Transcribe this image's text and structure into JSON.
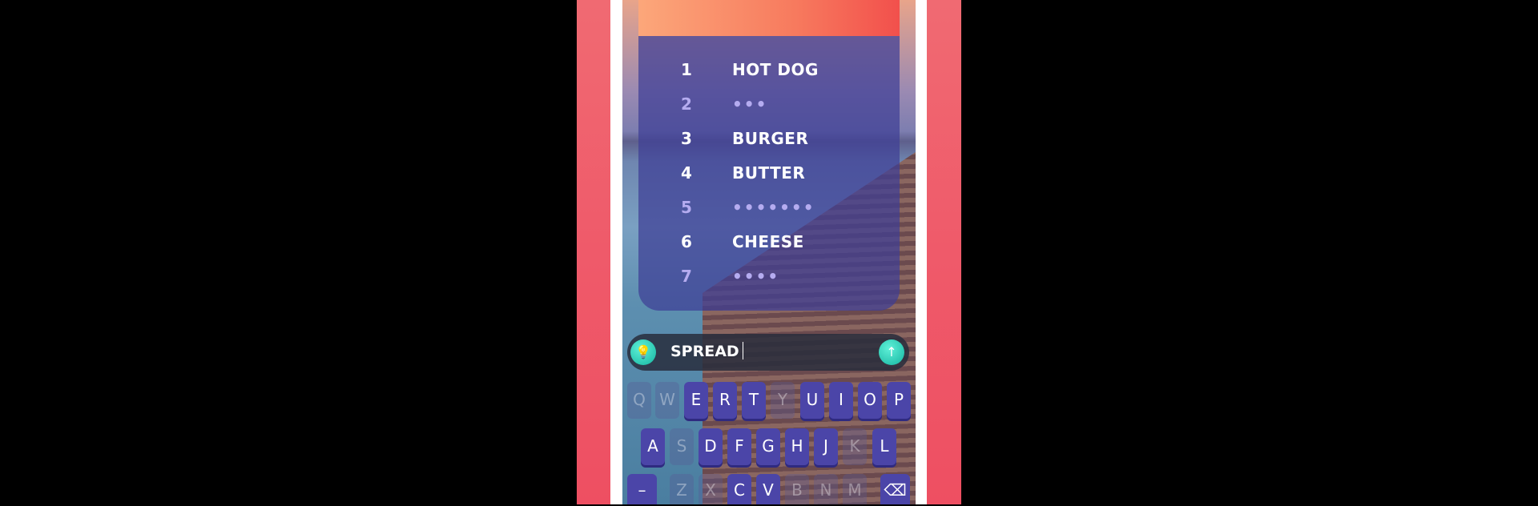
{
  "colors": {
    "side": "#ef5a6a",
    "panel": "#3e3e96",
    "key": "#4b45a8",
    "button": "#15b5a0"
  },
  "answers": [
    {
      "number": "1",
      "word": "HOT DOG",
      "revealed": true
    },
    {
      "number": "2",
      "word": "•••",
      "revealed": false
    },
    {
      "number": "3",
      "word": "BURGER",
      "revealed": true
    },
    {
      "number": "4",
      "word": "BUTTER",
      "revealed": true
    },
    {
      "number": "5",
      "word": "•••••••",
      "revealed": false
    },
    {
      "number": "6",
      "word": "CHEESE",
      "revealed": true
    },
    {
      "number": "7",
      "word": "••••",
      "revealed": false
    }
  ],
  "input": {
    "value": "SPREAD",
    "hint_icon": "lightbulb-icon",
    "submit_icon": "arrow-up-icon"
  },
  "keyboard": {
    "rows": [
      [
        {
          "k": "Q",
          "used": true
        },
        {
          "k": "W",
          "used": true
        },
        {
          "k": "E"
        },
        {
          "k": "R"
        },
        {
          "k": "T"
        },
        {
          "k": "Y",
          "used": true
        },
        {
          "k": "U"
        },
        {
          "k": "I"
        },
        {
          "k": "O"
        },
        {
          "k": "P"
        }
      ],
      [
        {
          "k": "A"
        },
        {
          "k": "S",
          "used": true
        },
        {
          "k": "D"
        },
        {
          "k": "F"
        },
        {
          "k": "G"
        },
        {
          "k": "H"
        },
        {
          "k": "J"
        },
        {
          "k": "K",
          "used": true
        },
        {
          "k": "L"
        }
      ],
      [
        {
          "k": "–"
        },
        {
          "k": "Z",
          "used": true
        },
        {
          "k": "X",
          "used": true
        },
        {
          "k": "C"
        },
        {
          "k": "V"
        },
        {
          "k": "B",
          "used": true
        },
        {
          "k": "N",
          "used": true
        },
        {
          "k": "M",
          "used": true
        },
        {
          "k": "⌫"
        }
      ]
    ]
  }
}
